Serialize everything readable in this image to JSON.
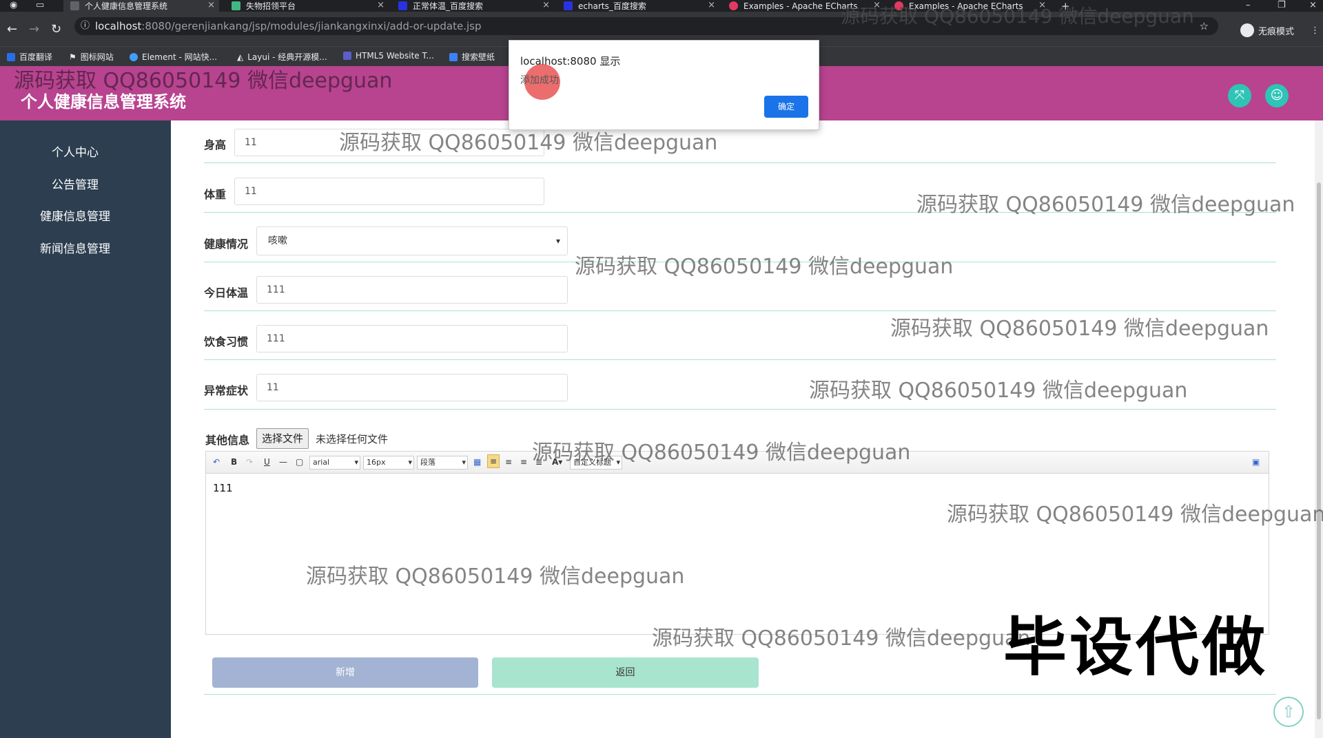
{
  "browser": {
    "tabs": [
      {
        "title": "个人健康信息管理系统",
        "active": true,
        "favicon_color": "#5f6368"
      },
      {
        "title": "失物招领平台",
        "active": false,
        "favicon_color": "#41b883"
      },
      {
        "title": "正常体温_百度搜索",
        "active": false,
        "favicon_color": "#2932e1"
      },
      {
        "title": "echarts_百度搜索",
        "active": false,
        "favicon_color": "#2932e1"
      },
      {
        "title": "Examples - Apache ECharts",
        "active": false,
        "favicon_color": "#e43961"
      },
      {
        "title": "Examples - Apache ECharts",
        "active": false,
        "favicon_color": "#e43961"
      }
    ],
    "new_tab": "+",
    "url_host": "localhost",
    "url_rest": ":8080/gerenjiankang/jsp/modules/jiankangxinxi/add-or-update.jsp",
    "incognito_label": "无痕模式",
    "bookmarks": [
      {
        "label": "百度翻译",
        "color": "#2b6de5"
      },
      {
        "label": "图标网站",
        "color": "#ffffff"
      },
      {
        "label": "Element - 网站快...",
        "color": "#409eff"
      },
      {
        "label": "Layui - 经典开源模...",
        "color": "#dddddd"
      },
      {
        "label": "HTML5 Website T...",
        "color": "#5b5fc7"
      },
      {
        "label": "搜索壁纸",
        "color": "#3b82f6"
      }
    ]
  },
  "header": {
    "title": "个人健康信息管理系统",
    "accent": "#b8438f"
  },
  "sidebar": {
    "items": [
      {
        "label": "个人中心"
      },
      {
        "label": "公告管理"
      },
      {
        "label": "健康信息管理"
      },
      {
        "label": "新闻信息管理"
      }
    ]
  },
  "form": {
    "height": {
      "label": "身高",
      "value": "11"
    },
    "weight": {
      "label": "体重",
      "value": "11"
    },
    "health": {
      "label": "健康情况",
      "value": "咳嗽"
    },
    "temperature": {
      "label": "今日体温",
      "value": "111"
    },
    "diet": {
      "label": "饮食习惯",
      "value": "111"
    },
    "symptoms": {
      "label": "异常症状",
      "value": "11"
    },
    "other": {
      "label": "其他信息",
      "file_button": "选择文件",
      "file_status": "未选择任何文件",
      "font_family": "arial",
      "font_size": "16px",
      "paragraph": "段落",
      "custom_title": "自定义标题",
      "content": "111"
    },
    "add_button": "新增",
    "back_button": "返回"
  },
  "alert": {
    "title": "localhost:8080 显示",
    "message": "添加成功",
    "ok": "确定"
  },
  "watermarks": {
    "text": "源码获取 QQ86050149 微信deepguan",
    "big": "毕设代做"
  }
}
